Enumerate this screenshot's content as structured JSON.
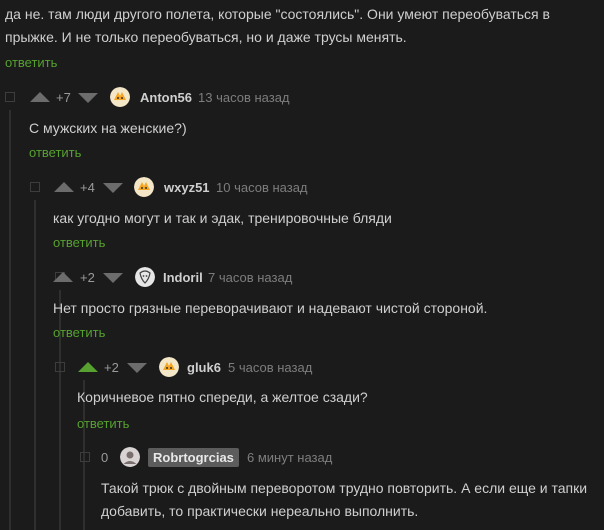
{
  "comment_top": {
    "text_line1": "да не. там люди другого полета, которые \"состоялись\". Они умеют переобуваться в",
    "text_line2": "прыжке. И не только переобуваться, но и даже трусы менять.",
    "reply_label": "ответить"
  },
  "comments": [
    {
      "rating": "+7",
      "username": "Anton56",
      "time": "13 часов назад",
      "text": "С мужских на женские?)",
      "reply_label": "ответить",
      "avatar_icon": "fox-avatar-icon"
    },
    {
      "rating": "+4",
      "username": "wxyz51",
      "time": "10 часов назад",
      "text": "как угодно могут и так и эдак, тренировочные бляди",
      "reply_label": "ответить",
      "avatar_icon": "fox-avatar-icon"
    },
    {
      "rating": "+2",
      "username": "Indoril",
      "time": "7 часов назад",
      "text": "Нет просто грязные переворачивают и надевают чистой стороной.",
      "reply_label": "ответить",
      "avatar_icon": "sketch-avatar-icon"
    },
    {
      "rating": "+2",
      "username": "gluk6",
      "time": "5 часов назад",
      "text": "Коричневое пятно спереди, а желтое сзади?",
      "reply_label": "ответить",
      "avatar_icon": "fox-avatar-icon"
    },
    {
      "rating": "0",
      "username": "Robrtogrcias",
      "time": "6 минут назад",
      "text_line1": "Такой трюк с двойным переворотом трудно повторить. А если еще и тапки",
      "text_line2": "добавить, то практически нереально выполнить.",
      "avatar_icon": "person-avatar-icon"
    }
  ],
  "colors": {
    "background": "#1b1b1c",
    "text": "#cfcfcf",
    "reply_link": "#56a12f",
    "vote_arrow": "#6c6c6c",
    "vote_arrow_active": "#56a12f"
  }
}
